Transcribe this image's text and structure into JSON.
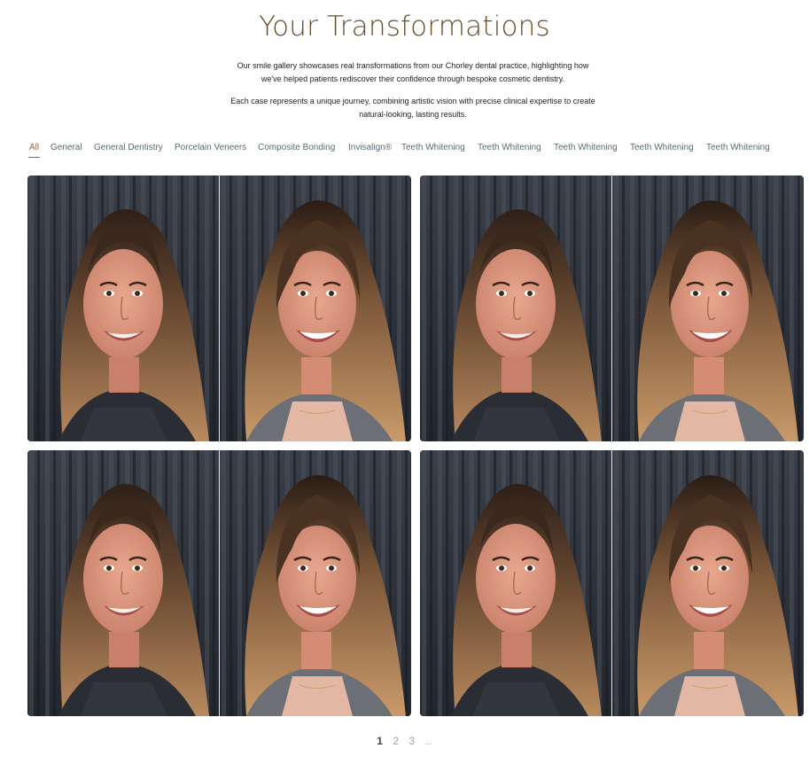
{
  "page": {
    "title": "Your Transformations",
    "intro_1": "Our smile gallery showcases real transformations from our Chorley dental practice, highlighting how we've helped patients rediscover their confidence through bespoke cosmetic dentistry.",
    "intro_2": "Each case represents a unique journey, combining artistic vision with precise clinical expertise to create natural-looking, lasting results."
  },
  "filters": [
    {
      "label": "All",
      "active": true
    },
    {
      "label": "General"
    },
    {
      "label": "General Dentistry"
    },
    {
      "label": "Porcelain Veneers"
    },
    {
      "label": "Composite Bonding"
    },
    {
      "label": "Invisalign®"
    },
    {
      "label": "Teeth Whitening"
    },
    {
      "label": "Teeth Whitening"
    },
    {
      "label": "Teeth Whitening"
    },
    {
      "label": "Teeth Whitening"
    },
    {
      "label": "Teeth Whitening"
    }
  ],
  "gallery": {
    "cards": [
      {
        "left_photo": "before-smile-photo",
        "right_photo": "after-smile-photo"
      },
      {
        "left_photo": "before-smile-photo",
        "right_photo": "after-smile-photo"
      },
      {
        "left_photo": "before-smile-photo",
        "right_photo": "after-smile-photo"
      },
      {
        "left_photo": "before-smile-photo",
        "right_photo": "after-smile-photo"
      }
    ]
  },
  "pagination": {
    "pages": [
      "1",
      "2",
      "3"
    ],
    "current": "1",
    "more": "..."
  },
  "colors": {
    "accent": "#8b6a3e",
    "title": "#6b4e2e",
    "filter_text": "#5a6a70"
  }
}
